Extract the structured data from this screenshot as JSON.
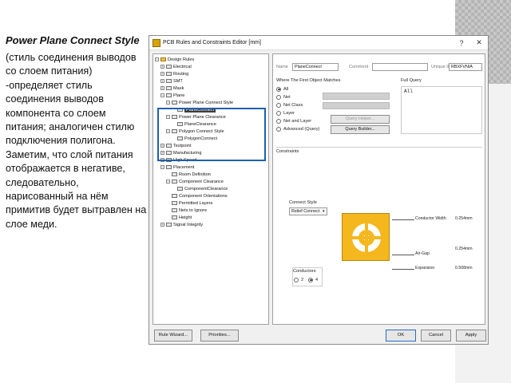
{
  "slide": {
    "title": "Power Plane Connect Style",
    "body": "(стиль соединения выводов со слоем питания) -определяет стиль соединения выводов компонента со слоем питания; аналогичен стилю подключения полигона. Заметим, что слой питания отображается в негативе, следовательно, нарисованный на нём примитив будет вытравлен на слое меди."
  },
  "window": {
    "title": "PCB Rules and Constraints Editor [mm]",
    "help_label": "?",
    "close_label": "✕"
  },
  "tree": {
    "items": [
      {
        "label": "Design Rules"
      },
      {
        "label": "Electrical"
      },
      {
        "label": "Routing"
      },
      {
        "label": "SMT"
      },
      {
        "label": "Mask"
      },
      {
        "label": "Plane"
      },
      {
        "label": "Power Plane Connect Style"
      },
      {
        "label": "PlaneConnect"
      },
      {
        "label": "Power Plane Clearance"
      },
      {
        "label": "PlaneClearance"
      },
      {
        "label": "Polygon Connect Style"
      },
      {
        "label": "PolygonConnect"
      },
      {
        "label": "Testpoint"
      },
      {
        "label": "Manufacturing"
      },
      {
        "label": "High Speed"
      },
      {
        "label": "Placement"
      },
      {
        "label": "Room Definition"
      },
      {
        "label": "Component Clearance"
      },
      {
        "label": "ComponentClearance"
      },
      {
        "label": "Component Orientations"
      },
      {
        "label": "Permitted Layers"
      },
      {
        "label": "Nets to Ignore"
      },
      {
        "label": "Height"
      },
      {
        "label": "Signal Integrity"
      }
    ]
  },
  "rule": {
    "name_label": "Name",
    "name_value": "PlaneConnect",
    "comment_label": "Comment",
    "comment_value": "",
    "uid_label": "Unique ID",
    "uid_value": "RBXFVNIA"
  },
  "match": {
    "title": "Where The First Object Matches",
    "options": [
      "All",
      "Net",
      "Net Class",
      "Layer",
      "Net and Layer",
      "Advanced (Query)"
    ],
    "selected": "All",
    "query_helper_label": "Query Helper...",
    "query_builder_label": "Query Builder..."
  },
  "full_query": {
    "title": "Full Query",
    "value": "All"
  },
  "constraints": {
    "title": "Constraints",
    "connect_style_label": "Connect Style",
    "connect_style_value": "Relief Connect",
    "conductors_label": "Conductors",
    "conductor_options": [
      "2",
      "4"
    ],
    "conductor_selected": "4",
    "conductor_width_label": "Conductor Width",
    "conductor_width_value": "0.254mm",
    "air_gap_label": "Air-Gap",
    "air_gap_value": "0.254mm",
    "expansion_label": "Expansion",
    "expansion_value": "0.508mm"
  },
  "footer": {
    "rule_wizard": "Rule Wizard...",
    "priorities": "Priorities...",
    "ok": "OK",
    "cancel": "Cancel",
    "apply": "Apply"
  },
  "colors": {
    "highlight_box": "#1f5fae",
    "pad_fill": "#f4b71d",
    "selection": "#3d3d3d"
  }
}
